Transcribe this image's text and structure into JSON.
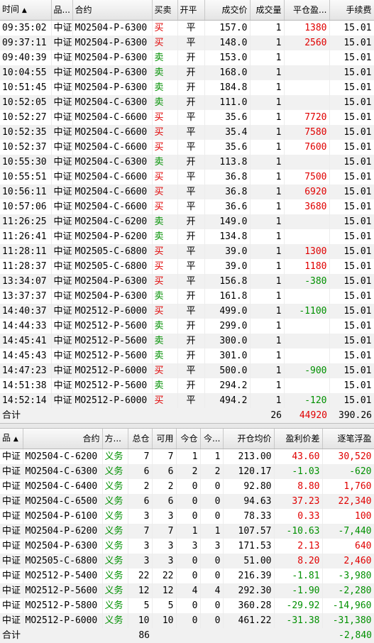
{
  "trades": {
    "headers": [
      "时间",
      "品...",
      "合约",
      "买卖",
      "开平",
      "成交价",
      "成交量",
      "平仓盈...",
      "手续费"
    ],
    "rows": [
      {
        "time": "09:35:02",
        "name": "中证",
        "contract": "MO2504-P-6300",
        "side": "买",
        "oc": "平",
        "price": "157.0",
        "qty": "1",
        "pnl": "1380",
        "fee": "15.01"
      },
      {
        "time": "09:37:11",
        "name": "中证",
        "contract": "MO2504-P-6300",
        "side": "买",
        "oc": "平",
        "price": "148.0",
        "qty": "1",
        "pnl": "2560",
        "fee": "15.01"
      },
      {
        "time": "09:40:39",
        "name": "中证",
        "contract": "MO2504-P-6300",
        "side": "卖",
        "oc": "开",
        "price": "153.0",
        "qty": "1",
        "pnl": "",
        "fee": "15.01"
      },
      {
        "time": "10:04:55",
        "name": "中证",
        "contract": "MO2504-P-6300",
        "side": "卖",
        "oc": "开",
        "price": "168.0",
        "qty": "1",
        "pnl": "",
        "fee": "15.01"
      },
      {
        "time": "10:51:45",
        "name": "中证",
        "contract": "MO2504-P-6300",
        "side": "卖",
        "oc": "开",
        "price": "184.8",
        "qty": "1",
        "pnl": "",
        "fee": "15.01"
      },
      {
        "time": "10:52:05",
        "name": "中证",
        "contract": "MO2504-C-6300",
        "side": "卖",
        "oc": "开",
        "price": "111.0",
        "qty": "1",
        "pnl": "",
        "fee": "15.01"
      },
      {
        "time": "10:52:27",
        "name": "中证",
        "contract": "MO2504-C-6600",
        "side": "买",
        "oc": "平",
        "price": "35.6",
        "qty": "1",
        "pnl": "7720",
        "fee": "15.01"
      },
      {
        "time": "10:52:35",
        "name": "中证",
        "contract": "MO2504-C-6600",
        "side": "买",
        "oc": "平",
        "price": "35.4",
        "qty": "1",
        "pnl": "7580",
        "fee": "15.01"
      },
      {
        "time": "10:52:37",
        "name": "中证",
        "contract": "MO2504-C-6600",
        "side": "买",
        "oc": "平",
        "price": "35.6",
        "qty": "1",
        "pnl": "7600",
        "fee": "15.01"
      },
      {
        "time": "10:55:30",
        "name": "中证",
        "contract": "MO2504-C-6300",
        "side": "卖",
        "oc": "开",
        "price": "113.8",
        "qty": "1",
        "pnl": "",
        "fee": "15.01"
      },
      {
        "time": "10:55:51",
        "name": "中证",
        "contract": "MO2504-C-6600",
        "side": "买",
        "oc": "平",
        "price": "36.8",
        "qty": "1",
        "pnl": "7500",
        "fee": "15.01"
      },
      {
        "time": "10:56:11",
        "name": "中证",
        "contract": "MO2504-C-6600",
        "side": "买",
        "oc": "平",
        "price": "36.8",
        "qty": "1",
        "pnl": "6920",
        "fee": "15.01"
      },
      {
        "time": "10:57:06",
        "name": "中证",
        "contract": "MO2504-C-6600",
        "side": "买",
        "oc": "平",
        "price": "36.6",
        "qty": "1",
        "pnl": "3680",
        "fee": "15.01"
      },
      {
        "time": "11:26:25",
        "name": "中证",
        "contract": "MO2504-C-6200",
        "side": "卖",
        "oc": "开",
        "price": "149.0",
        "qty": "1",
        "pnl": "",
        "fee": "15.01"
      },
      {
        "time": "11:26:41",
        "name": "中证",
        "contract": "MO2504-P-6200",
        "side": "卖",
        "oc": "开",
        "price": "134.8",
        "qty": "1",
        "pnl": "",
        "fee": "15.01"
      },
      {
        "time": "11:28:11",
        "name": "中证",
        "contract": "MO2505-C-6800",
        "side": "买",
        "oc": "平",
        "price": "39.0",
        "qty": "1",
        "pnl": "1300",
        "fee": "15.01"
      },
      {
        "time": "11:28:37",
        "name": "中证",
        "contract": "MO2505-C-6800",
        "side": "买",
        "oc": "平",
        "price": "39.0",
        "qty": "1",
        "pnl": "1180",
        "fee": "15.01"
      },
      {
        "time": "13:34:07",
        "name": "中证",
        "contract": "MO2504-P-6300",
        "side": "买",
        "oc": "平",
        "price": "156.8",
        "qty": "1",
        "pnl": "-380",
        "fee": "15.01"
      },
      {
        "time": "13:37:37",
        "name": "中证",
        "contract": "MO2504-P-6300",
        "side": "卖",
        "oc": "开",
        "price": "161.8",
        "qty": "1",
        "pnl": "",
        "fee": "15.01"
      },
      {
        "time": "14:40:37",
        "name": "中证",
        "contract": "MO2512-P-6000",
        "side": "买",
        "oc": "平",
        "price": "499.0",
        "qty": "1",
        "pnl": "-1100",
        "fee": "15.01"
      },
      {
        "time": "14:44:33",
        "name": "中证",
        "contract": "MO2512-P-5600",
        "side": "卖",
        "oc": "开",
        "price": "299.0",
        "qty": "1",
        "pnl": "",
        "fee": "15.01"
      },
      {
        "time": "14:45:41",
        "name": "中证",
        "contract": "MO2512-P-5600",
        "side": "卖",
        "oc": "开",
        "price": "300.0",
        "qty": "1",
        "pnl": "",
        "fee": "15.01"
      },
      {
        "time": "14:45:43",
        "name": "中证",
        "contract": "MO2512-P-5600",
        "side": "卖",
        "oc": "开",
        "price": "301.0",
        "qty": "1",
        "pnl": "",
        "fee": "15.01"
      },
      {
        "time": "14:47:23",
        "name": "中证",
        "contract": "MO2512-P-6000",
        "side": "买",
        "oc": "平",
        "price": "500.0",
        "qty": "1",
        "pnl": "-900",
        "fee": "15.01"
      },
      {
        "time": "14:51:38",
        "name": "中证",
        "contract": "MO2512-P-5600",
        "side": "卖",
        "oc": "开",
        "price": "294.2",
        "qty": "1",
        "pnl": "",
        "fee": "15.01"
      },
      {
        "time": "14:52:14",
        "name": "中证",
        "contract": "MO2512-P-6000",
        "side": "买",
        "oc": "平",
        "price": "494.2",
        "qty": "1",
        "pnl": "-120",
        "fee": "15.01"
      }
    ],
    "total": {
      "label": "合计",
      "qty": "26",
      "pnl": "44920",
      "fee": "390.26"
    }
  },
  "positions": {
    "headers": [
      "品",
      "合约",
      "方...",
      "总仓",
      "可用",
      "今仓",
      "今...",
      "开仓均价",
      "盈利价差",
      "逐笔浮盈"
    ],
    "rows": [
      {
        "name": "中证",
        "contract": "MO2504-C-6200",
        "dir": "义务",
        "total": "7",
        "avail": "7",
        "today": "1",
        "today2": "1",
        "avg": "213.00",
        "spread": "43.60",
        "float": "30,520"
      },
      {
        "name": "中证",
        "contract": "MO2504-C-6300",
        "dir": "义务",
        "total": "6",
        "avail": "6",
        "today": "2",
        "today2": "2",
        "avg": "120.17",
        "spread": "-1.03",
        "float": "-620"
      },
      {
        "name": "中证",
        "contract": "MO2504-C-6400",
        "dir": "义务",
        "total": "2",
        "avail": "2",
        "today": "0",
        "today2": "0",
        "avg": "92.80",
        "spread": "8.80",
        "float": "1,760"
      },
      {
        "name": "中证",
        "contract": "MO2504-C-6500",
        "dir": "义务",
        "total": "6",
        "avail": "6",
        "today": "0",
        "today2": "0",
        "avg": "94.63",
        "spread": "37.23",
        "float": "22,340"
      },
      {
        "name": "中证",
        "contract": "MO2504-P-6100",
        "dir": "义务",
        "total": "3",
        "avail": "3",
        "today": "0",
        "today2": "0",
        "avg": "78.33",
        "spread": "0.33",
        "float": "100"
      },
      {
        "name": "中证",
        "contract": "MO2504-P-6200",
        "dir": "义务",
        "total": "7",
        "avail": "7",
        "today": "1",
        "today2": "1",
        "avg": "107.57",
        "spread": "-10.63",
        "float": "-7,440"
      },
      {
        "name": "中证",
        "contract": "MO2504-P-6300",
        "dir": "义务",
        "total": "3",
        "avail": "3",
        "today": "3",
        "today2": "3",
        "avg": "171.53",
        "spread": "2.13",
        "float": "640"
      },
      {
        "name": "中证",
        "contract": "MO2505-C-6800",
        "dir": "义务",
        "total": "3",
        "avail": "3",
        "today": "0",
        "today2": "0",
        "avg": "51.00",
        "spread": "8.20",
        "float": "2,460"
      },
      {
        "name": "中证",
        "contract": "MO2512-P-5400",
        "dir": "义务",
        "total": "22",
        "avail": "22",
        "today": "0",
        "today2": "0",
        "avg": "216.39",
        "spread": "-1.81",
        "float": "-3,980"
      },
      {
        "name": "中证",
        "contract": "MO2512-P-5600",
        "dir": "义务",
        "total": "12",
        "avail": "12",
        "today": "4",
        "today2": "4",
        "avg": "292.30",
        "spread": "-1.90",
        "float": "-2,280"
      },
      {
        "name": "中证",
        "contract": "MO2512-P-5800",
        "dir": "义务",
        "total": "5",
        "avail": "5",
        "today": "0",
        "today2": "0",
        "avg": "360.28",
        "spread": "-29.92",
        "float": "-14,960"
      },
      {
        "name": "中证",
        "contract": "MO2512-P-6000",
        "dir": "义务",
        "total": "10",
        "avail": "10",
        "today": "0",
        "today2": "0",
        "avg": "461.22",
        "spread": "-31.38",
        "float": "-31,380"
      }
    ],
    "total": {
      "label": "合计",
      "total": "86",
      "float": "-2,840"
    }
  },
  "colors": {
    "buy": "#e00000",
    "sell": "#009000",
    "loss": "#009000",
    "profit": "#e00000"
  }
}
